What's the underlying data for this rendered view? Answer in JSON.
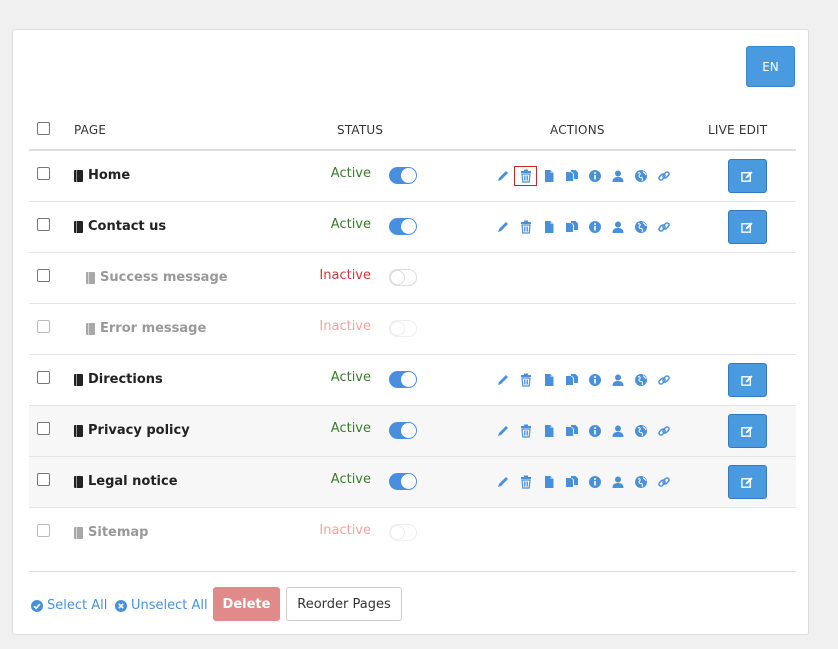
{
  "language_button": "EN",
  "headers": {
    "page": "PAGE",
    "status": "STATUS",
    "actions": "ACTIONS",
    "live_edit": "LIVE EDIT"
  },
  "colors": {
    "accent": "#4a9ae0",
    "active": "#3c7a2f",
    "inactive": "#d0383a",
    "delete": "#e08b89"
  },
  "action_icons": [
    "pencil-icon",
    "trash-icon",
    "file-icon",
    "copy-icon",
    "info-icon",
    "user-icon",
    "globe-icon",
    "link-icon"
  ],
  "rows": [
    {
      "name": "Home",
      "status": "Active"
    },
    {
      "name": "Contact us",
      "status": "Active"
    },
    {
      "name": "Success message",
      "status": "Inactive"
    },
    {
      "name": "Error message",
      "status": "Inactive"
    },
    {
      "name": "Directions",
      "status": "Active"
    },
    {
      "name": "Privacy policy",
      "status": "Active"
    },
    {
      "name": "Legal notice",
      "status": "Active"
    },
    {
      "name": "Sitemap",
      "status": "Inactive"
    }
  ],
  "footer": {
    "select_all": "Select All",
    "unselect_all": "Unselect All",
    "delete": "Delete",
    "reorder": "Reorder Pages"
  }
}
